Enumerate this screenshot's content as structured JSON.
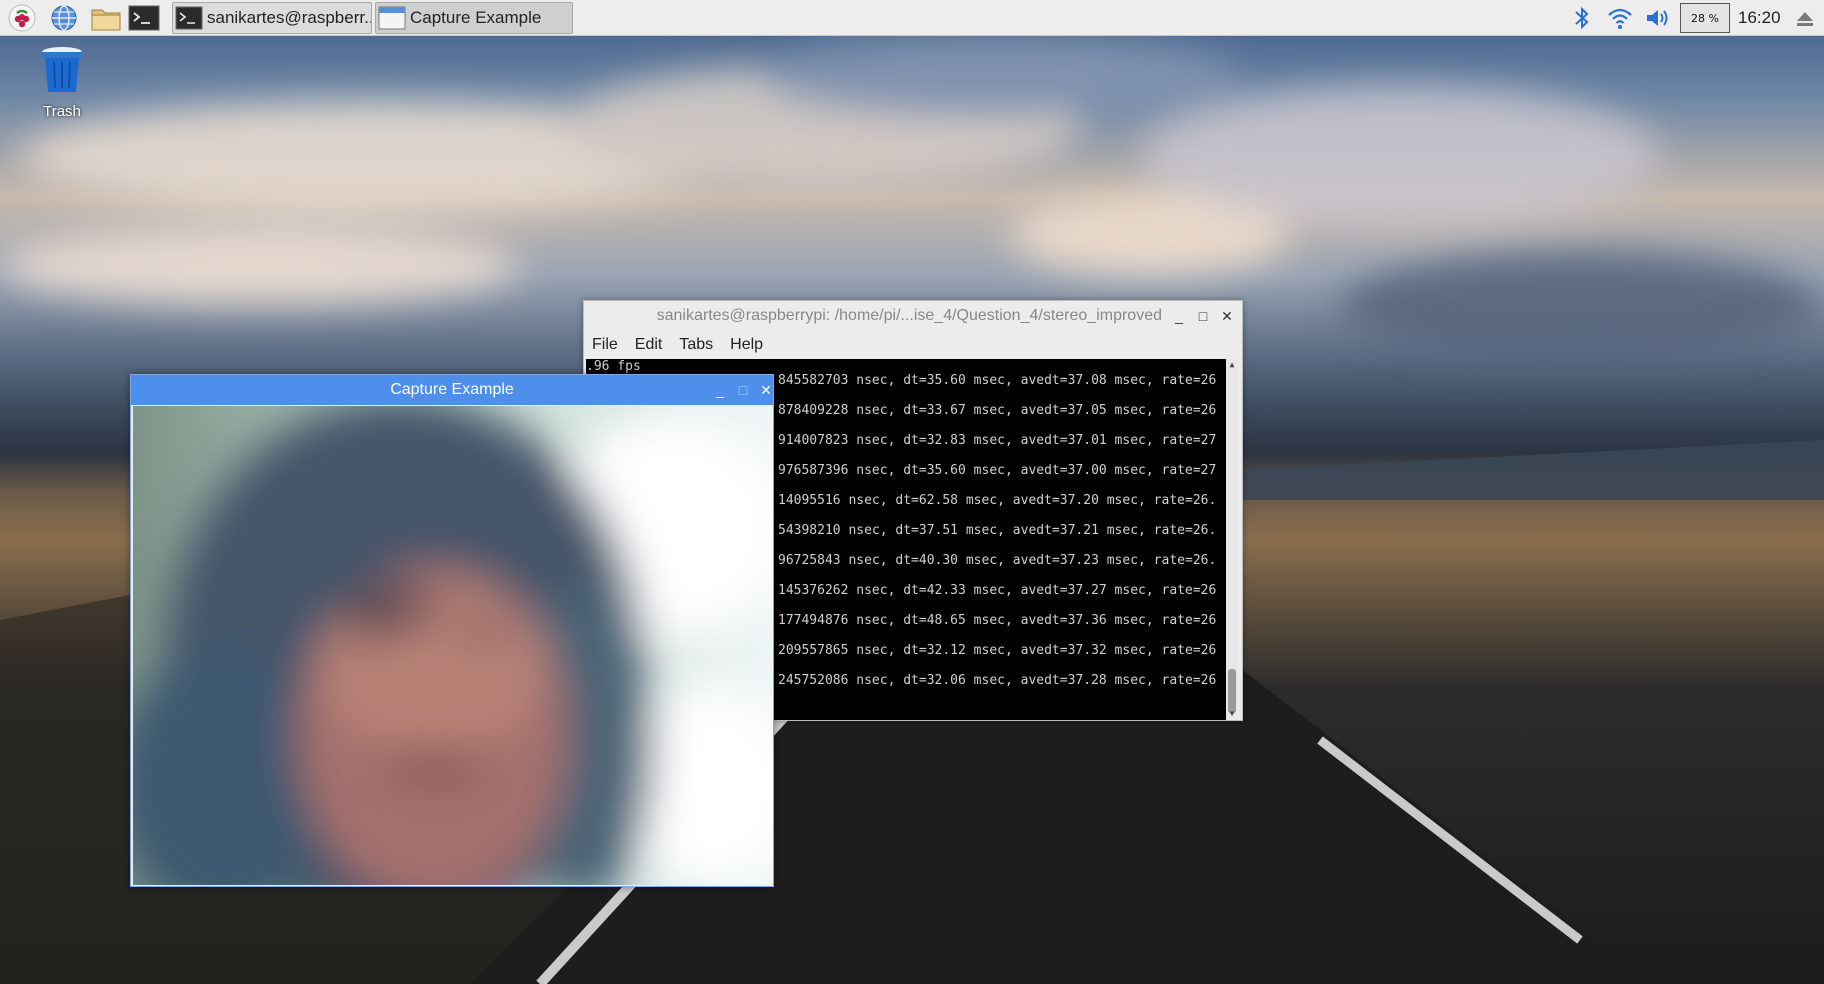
{
  "taskbar": {
    "launchers": [
      {
        "icon": "raspberry-icon"
      },
      {
        "icon": "web-browser-icon"
      },
      {
        "icon": "file-manager-icon"
      },
      {
        "icon": "terminal-icon"
      }
    ],
    "tasks": [
      {
        "label": "sanikartes@raspberr...",
        "icon": "terminal-icon"
      },
      {
        "label": "Capture Example",
        "icon": "window-icon"
      }
    ],
    "tray": {
      "cpu": "28 %",
      "clock": "16:20",
      "icons": [
        "bluetooth-icon",
        "wifi-icon",
        "volume-icon",
        "eject-icon"
      ]
    }
  },
  "desktop": {
    "trash_label": "Trash"
  },
  "terminal": {
    "title": "sanikartes@raspberrypi: /home/pi/...ise_4/Question_4/stereo_improved",
    "menu": [
      "File",
      "Edit",
      "Tabs",
      "Help"
    ],
    "lines": [
      ".96 fps",
      "845582703 nsec, dt=35.60 msec, avedt=37.08 msec, rate=26",
      "878409228 nsec, dt=33.67 msec, avedt=37.05 msec, rate=26",
      "914007823 nsec, dt=32.83 msec, avedt=37.01 msec, rate=27",
      "976587396 nsec, dt=35.60 msec, avedt=37.00 msec, rate=27",
      "14095516 nsec, dt=62.58 msec, avedt=37.20 msec, rate=26.",
      "54398210 nsec, dt=37.51 msec, avedt=37.21 msec, rate=26.",
      "96725843 nsec, dt=40.30 msec, avedt=37.23 msec, rate=26.",
      "145376262 nsec, dt=42.33 msec, avedt=37.27 msec, rate=26",
      "177494876 nsec, dt=48.65 msec, avedt=37.36 msec, rate=26",
      "209557865 nsec, dt=32.12 msec, avedt=37.32 msec, rate=26",
      "245752086 nsec, dt=32.06 msec, avedt=37.28 msec, rate=26"
    ]
  },
  "capture": {
    "title": "Capture Example"
  },
  "colors": {
    "capture_titlebar": "#4d8fea",
    "taskbar_bg": "#ededed",
    "terminal_bg": "#000000"
  }
}
